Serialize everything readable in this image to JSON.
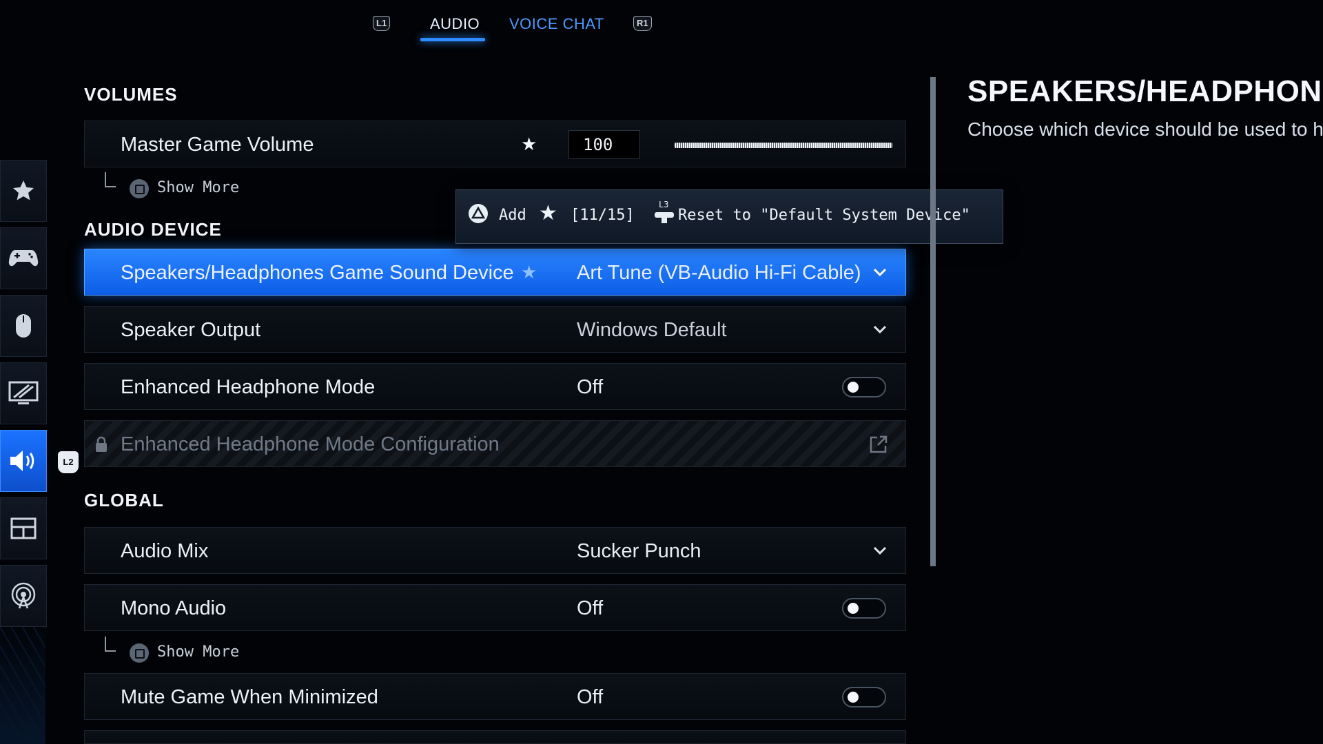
{
  "tabs": {
    "left_button": "L1",
    "right_button": "R1",
    "items": [
      {
        "label": "AUDIO",
        "active": true
      },
      {
        "label": "VOICE CHAT",
        "active": false
      }
    ]
  },
  "sidenav": {
    "items": [
      "favorites-icon",
      "controller-icon",
      "mouse-icon",
      "display-icon",
      "audio-icon",
      "interface-icon",
      "network-icon"
    ],
    "active": "audio-icon",
    "side_badge": "L2"
  },
  "volumes": {
    "title": "VOLUMES",
    "master": {
      "label": "Master Game Volume",
      "value": "100",
      "level_percent": 100
    },
    "show_more": "Show More"
  },
  "tooltip": {
    "action_add": "Add",
    "favorites_count": "[11/15]",
    "reset_button": "L3",
    "reset_text": "Reset to \"Default System Device\""
  },
  "audio_device": {
    "title": "AUDIO DEVICE",
    "rows": [
      {
        "label": "Speakers/Headphones Game Sound Device",
        "value": "Art Tune (VB-Audio Hi-Fi Cable)"
      },
      {
        "label": "Speaker Output",
        "value": "Windows Default"
      },
      {
        "label": "Enhanced Headphone Mode",
        "value": "Off"
      },
      {
        "label": "Enhanced Headphone Mode Configuration"
      }
    ]
  },
  "global": {
    "title": "GLOBAL",
    "rows": [
      {
        "label": "Audio Mix",
        "value": "Sucker Punch"
      },
      {
        "label": "Mono Audio",
        "value": "Off"
      },
      {
        "label": "Mute Game When Minimized",
        "value": "Off"
      }
    ],
    "show_more": "Show More"
  },
  "details": {
    "title": "SPEAKERS/HEADPHONES",
    "description": "Choose which device should be used to hear"
  },
  "colors": {
    "accent": "#1a73ff",
    "background": "#010306"
  }
}
